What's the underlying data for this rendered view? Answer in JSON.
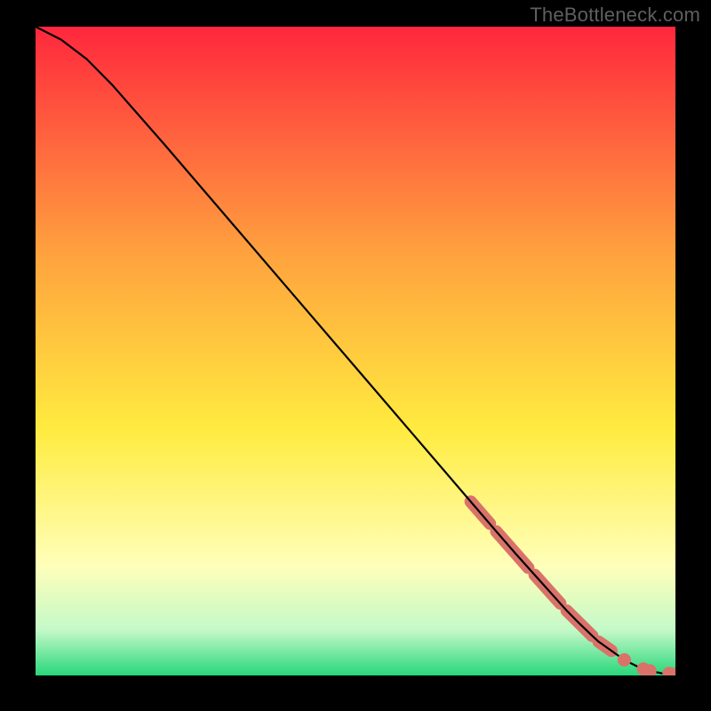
{
  "watermark": "TheBottleneck.com",
  "chart_data": {
    "type": "line",
    "title": "",
    "xlabel": "",
    "ylabel": "",
    "xlim": [
      0,
      100
    ],
    "ylim": [
      0,
      100
    ],
    "grid": false,
    "legend": false,
    "series": [
      {
        "name": "curve",
        "x": [
          0,
          4,
          8,
          12,
          20,
          30,
          40,
          50,
          60,
          68,
          72,
          75,
          78,
          81,
          83,
          85,
          87,
          88,
          90,
          92,
          94,
          96,
          98,
          100
        ],
        "y": [
          100,
          98,
          95,
          91,
          82,
          70.5,
          59,
          47.5,
          36,
          26.8,
          22.2,
          18.8,
          15.5,
          12.2,
          10.0,
          8.0,
          6.1,
          5.2,
          3.8,
          2.4,
          1.4,
          0.7,
          0.3,
          0.2
        ]
      }
    ],
    "highlight_clusters": [
      {
        "x_start": 68,
        "x_end": 71,
        "y_start": 26.8,
        "y_end": 23.4
      },
      {
        "x_start": 72,
        "x_end": 77,
        "y_start": 22.2,
        "y_end": 16.6
      },
      {
        "x_start": 78,
        "x_end": 82,
        "y_start": 15.5,
        "y_end": 11.1
      },
      {
        "x_start": 83,
        "x_end": 87,
        "y_start": 10.0,
        "y_end": 6.1
      },
      {
        "x_start": 88,
        "x_end": 90,
        "y_start": 5.2,
        "y_end": 3.8
      }
    ],
    "highlight_points": [
      {
        "x": 92,
        "y": 2.4
      },
      {
        "x": 95,
        "y": 1.0
      },
      {
        "x": 96,
        "y": 0.7
      },
      {
        "x": 99,
        "y": 0.3
      },
      {
        "x": 100,
        "y": 0.2
      }
    ],
    "gradient_stops": [
      {
        "offset": 0.0,
        "class": "stop-red"
      },
      {
        "offset": 0.35,
        "class": "stop-orange"
      },
      {
        "offset": 0.62,
        "class": "stop-yellow"
      },
      {
        "offset": 0.83,
        "class": "stop-paleY"
      },
      {
        "offset": 0.93,
        "class": "stop-paleG"
      },
      {
        "offset": 1.0,
        "class": "stop-green"
      }
    ]
  }
}
